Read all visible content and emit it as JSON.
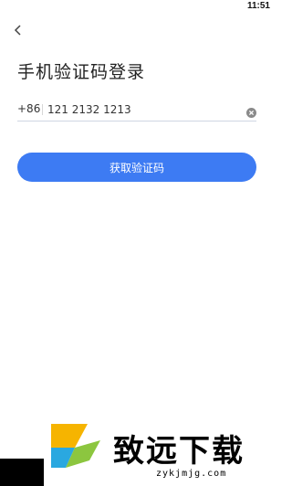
{
  "status_bar": {
    "time": "11:51"
  },
  "page": {
    "title": "手机验证码登录"
  },
  "phone": {
    "country_code": "+86",
    "value": "121 2132 1213"
  },
  "actions": {
    "get_code_label": "获取验证码"
  },
  "watermark": {
    "name": "致远下载",
    "url": "zykjmjg.com"
  },
  "colors": {
    "accent": "#3d7bf3"
  },
  "icons": {
    "back": "back-arrow-icon",
    "clear": "clear-icon",
    "logo": "brand-logo-icon"
  }
}
